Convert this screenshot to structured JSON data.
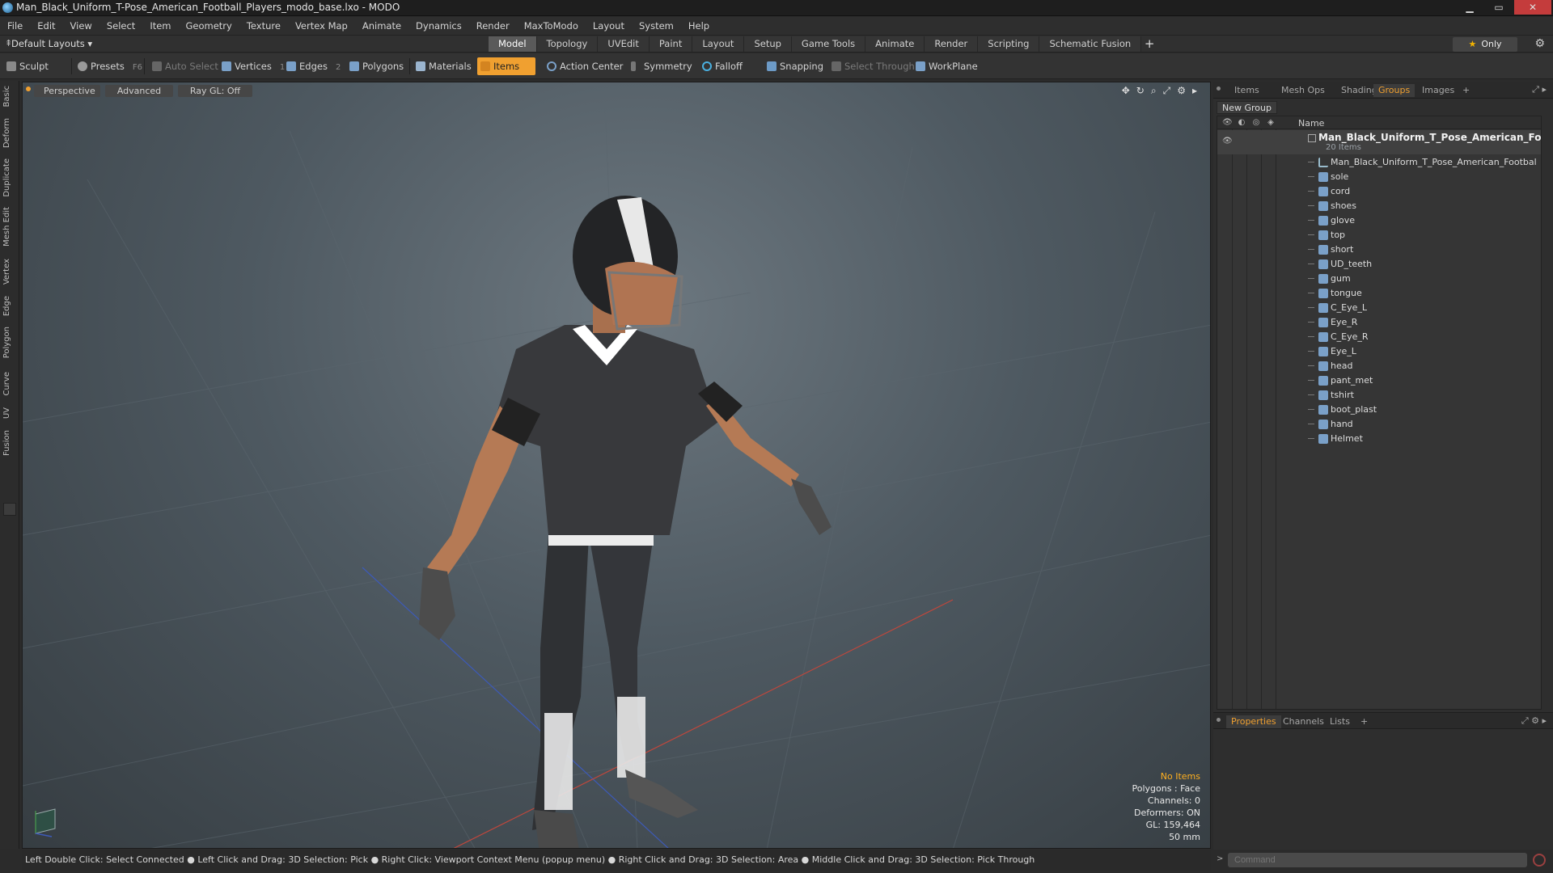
{
  "window": {
    "title": "Man_Black_Uniform_T-Pose_American_Football_Players_modo_base.lxo - MODO",
    "min_glyph": "▁",
    "max_glyph": "▭",
    "close_glyph": "✕"
  },
  "menu": [
    "File",
    "Edit",
    "View",
    "Select",
    "Item",
    "Geometry",
    "Texture",
    "Vertex Map",
    "Animate",
    "Dynamics",
    "Render",
    "MaxToModo",
    "Layout",
    "System",
    "Help"
  ],
  "layout_bar": {
    "preset": "Default Layouts ▾",
    "tabs": [
      "Model",
      "Topology",
      "UVEdit",
      "Paint",
      "Layout",
      "Setup",
      "Game Tools",
      "Animate",
      "Render",
      "Scripting",
      "Schematic Fusion"
    ],
    "active_tab": "Model",
    "add": "+",
    "only_label": "Only",
    "star": "★",
    "gear": "⚙"
  },
  "toolbar": {
    "sculpt": "Sculpt",
    "presets": "Presets",
    "presets_key": "F6",
    "auto_select": "Auto Select",
    "vertices": "Vertices",
    "vertices_count": "1",
    "edges": "Edges",
    "edges_count": "2",
    "polygons": "Polygons",
    "materials": "Materials",
    "items": "Items",
    "action_center": "Action Center",
    "symmetry": "Symmetry",
    "falloff": "Falloff",
    "snapping": "Snapping",
    "select_through": "Select Through",
    "workplane": "WorkPlane"
  },
  "left_tabs": [
    "Basic",
    "Deform",
    "Duplicate",
    "Mesh Edit",
    "Vertex",
    "Edge",
    "Polygon",
    "Curve",
    "UV",
    "Fusion"
  ],
  "viewport": {
    "perspective": "Perspective",
    "advanced": "Advanced",
    "raygl": "Ray GL: Off",
    "icons": [
      "✥",
      "↻",
      "⌕",
      "⤢",
      "⚙",
      "▸"
    ],
    "info": {
      "no_items": "No Items",
      "polygons": "Polygons : Face",
      "channels": "Channels: 0",
      "deformers": "Deformers: ON",
      "gl": "GL: 159,464",
      "lens": "50 mm"
    }
  },
  "right_panel": {
    "tabs": [
      "Items",
      "Mesh Ops",
      "Shading",
      "Groups",
      "Images",
      "+"
    ],
    "active_tab": "Groups",
    "new_group": "New Group",
    "name_header": "Name",
    "group_name": "Man_Black_Uniform_T_Pose_American_Foot ...",
    "group_count": "20 Items",
    "items": [
      "Man_Black_Uniform_T_Pose_American_Football_Pla...",
      "sole",
      "cord",
      "shoes",
      "glove",
      "top",
      "short",
      "UD_teeth",
      "gum",
      "tongue",
      "C_Eye_L",
      "Eye_R",
      "C_Eye_R",
      "Eye_L",
      "head",
      "pant_met",
      "tshirt",
      "boot_plast",
      "hand",
      "Helmet"
    ]
  },
  "props_panel": {
    "tabs": [
      "Properties",
      "Channels",
      "Lists",
      "+"
    ],
    "active_tab": "Properties"
  },
  "command": {
    "placeholder": "Command"
  },
  "status": "Left Double Click: Select Connected ● Left Click and Drag: 3D Selection: Pick ● Right Click: Viewport Context Menu (popup menu) ● Right Click and Drag: 3D Selection: Area ● Middle Click and Drag: 3D Selection: Pick Through",
  "colors": {
    "accent": "#f0a030",
    "viewport_top": "#6d7880",
    "viewport_bottom": "#363d42"
  }
}
